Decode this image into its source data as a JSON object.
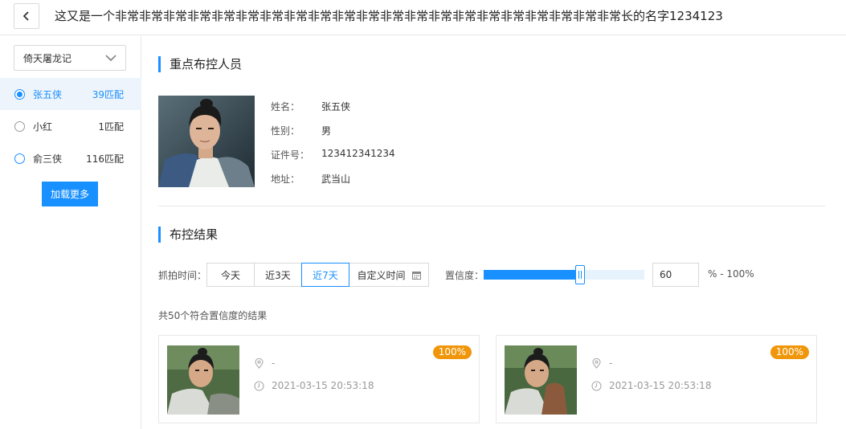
{
  "header": {
    "title": "这又是一个非常非常非常非常非常非常非常非常非常非常非常非常非常非常非常非常非常非常非常非常非常长的名字1234123"
  },
  "sidebar": {
    "group_select": "倚天屠龙记",
    "persons": [
      {
        "name": "张五侠",
        "count": "39匹配"
      },
      {
        "name": "小红",
        "count": "1匹配"
      },
      {
        "name": "俞三侠",
        "count": "116匹配"
      }
    ],
    "load_more": "加载更多"
  },
  "profile": {
    "section_title": "重点布控人员",
    "fields": [
      {
        "label": "姓名：",
        "value": "张五侠"
      },
      {
        "label": "性别：",
        "value": "男"
      },
      {
        "label": "证件号：",
        "value": "123412341234"
      },
      {
        "label": "地址：",
        "value": "武当山"
      }
    ]
  },
  "results": {
    "section_title": "布控结果",
    "capture_time_label": "抓拍时间：",
    "time_options": [
      "今天",
      "近3天",
      "近7天",
      "自定义时间"
    ],
    "selected_time": "近7天",
    "confidence_label": "置信度：",
    "confidence_value": "60",
    "confidence_suffix": "% - 100%",
    "slider_level": 0.6,
    "result_summary": "共50个符合置信度的结果",
    "cards": [
      {
        "badge": "100%",
        "location": "-",
        "time": "2021-03-15 20:53:18"
      },
      {
        "badge": "100%",
        "location": "-",
        "time": "2021-03-15 20:53:18"
      }
    ]
  },
  "colors": {
    "accent": "#1890ff",
    "badge": "#f0960a"
  }
}
